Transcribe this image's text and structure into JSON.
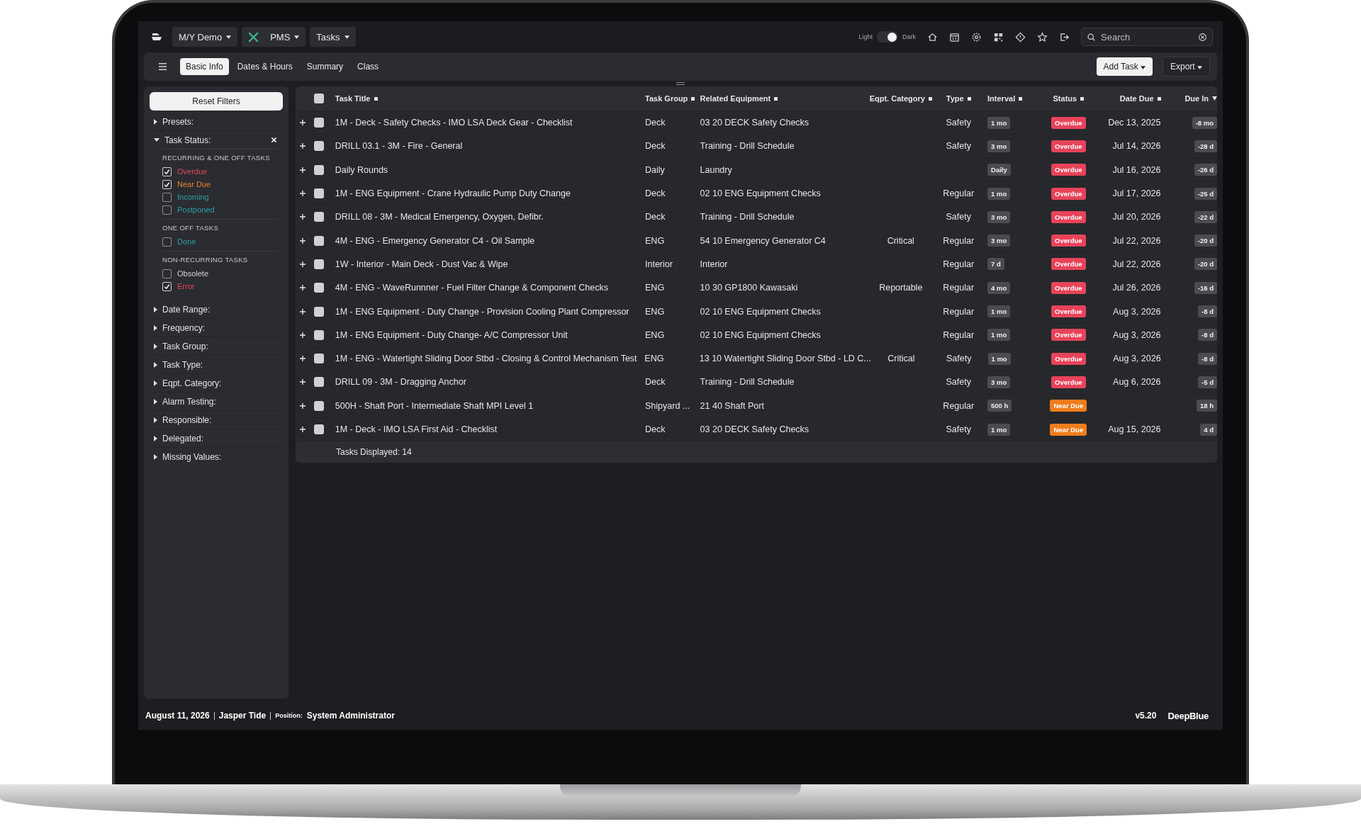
{
  "topbar": {
    "menus": [
      {
        "label": "M/Y Demo",
        "kind": "plain"
      },
      {
        "label": "PMS",
        "kind": "tools"
      },
      {
        "label": "Tasks",
        "kind": "plain"
      }
    ],
    "theme": {
      "light_label": "Light",
      "dark_label": "Dark",
      "on": true
    },
    "search": {
      "placeholder": "Search"
    }
  },
  "subbar": {
    "tabs": [
      {
        "label": "Basic Info",
        "selected": true
      },
      {
        "label": "Dates & Hours",
        "selected": false
      },
      {
        "label": "Summary",
        "selected": false
      },
      {
        "label": "Class",
        "selected": false
      }
    ],
    "buttons": [
      {
        "label": "Add Task",
        "kind": "primary"
      },
      {
        "label": "Export",
        "kind": "secondary"
      }
    ]
  },
  "sidebar": {
    "reset": "Reset Filters",
    "filters": [
      {
        "label": "Presets:",
        "expanded": false
      },
      {
        "label": "Task Status:",
        "expanded": true,
        "groups": [
          {
            "heading": "RECURRING & ONE OFF TASKS",
            "options": [
              {
                "label": "Overdue",
                "checked": true,
                "color": "#e8435a"
              },
              {
                "label": "Near Due",
                "checked": true,
                "color": "#ee7f2d"
              },
              {
                "label": "Incoming",
                "checked": false,
                "color": "#2b9fa6"
              },
              {
                "label": "Postponed",
                "checked": false,
                "color": "#2b9fa6"
              }
            ]
          },
          {
            "heading": "ONE OFF TASKS",
            "options": [
              {
                "label": "Done",
                "checked": false,
                "color": "#2b9fa6"
              }
            ]
          },
          {
            "heading": "NON-RECURRING TASKS",
            "options": [
              {
                "label": "Obsolete",
                "checked": false,
                "color": "#d4d5d8"
              },
              {
                "label": "Error",
                "checked": true,
                "color": "#e8435a"
              }
            ]
          }
        ]
      },
      {
        "label": "Date Range:",
        "expanded": false
      },
      {
        "label": "Frequency:",
        "expanded": false
      },
      {
        "label": "Task Group:",
        "expanded": false
      },
      {
        "label": "Task Type:",
        "expanded": false
      },
      {
        "label": "Eqpt. Category:",
        "expanded": false
      },
      {
        "label": "Alarm Testing:",
        "expanded": false
      },
      {
        "label": "Responsible:",
        "expanded": false
      },
      {
        "label": "Delegated:",
        "expanded": false
      },
      {
        "label": "Missing Values:",
        "expanded": false
      }
    ]
  },
  "table": {
    "select_all_checked": false,
    "columns": [
      {
        "label": "Task Title",
        "sorted": false
      },
      {
        "label": "Task Group",
        "sorted": false
      },
      {
        "label": "Related Equipment",
        "sorted": false
      },
      {
        "label": "Eqpt. Category",
        "sorted": false
      },
      {
        "label": "Type",
        "sorted": false
      },
      {
        "label": "Interval",
        "sorted": false
      },
      {
        "label": "Status",
        "sorted": false
      },
      {
        "label": "Date Due",
        "sorted": false
      },
      {
        "label": "Due In",
        "sorted": true
      }
    ],
    "rows": [
      {
        "checked": false,
        "title": "1M - Deck - Safety Checks - IMO LSA Deck Gear - Checklist",
        "group": "Deck",
        "equipment": "03 20 DECK Safety Checks",
        "category": "",
        "type": "Safety",
        "interval": "1 mo",
        "status": {
          "label": "Overdue",
          "kind": "overdue"
        },
        "date_due": "Dec 13, 2025",
        "due_in": "-8 mo"
      },
      {
        "checked": false,
        "title": "DRILL 03.1 - 3M - Fire - General",
        "group": "Deck",
        "equipment": "Training - Drill Schedule",
        "category": "",
        "type": "Safety",
        "interval": "3 mo",
        "status": {
          "label": "Overdue",
          "kind": "overdue"
        },
        "date_due": "Jul 14, 2026",
        "due_in": "-28 d"
      },
      {
        "checked": false,
        "title": "Daily Rounds",
        "group": "Daily",
        "equipment": "Laundry",
        "category": "",
        "type": "",
        "interval": "Daily",
        "status": {
          "label": "Overdue",
          "kind": "overdue"
        },
        "date_due": "Jul 16, 2026",
        "due_in": "-26 d"
      },
      {
        "checked": false,
        "title": "1M - ENG Equipment - Crane Hydraulic Pump Duty Change",
        "group": "Deck",
        "equipment": "02 10 ENG Equipment Checks",
        "category": "",
        "type": "Regular",
        "interval": "1 mo",
        "status": {
          "label": "Overdue",
          "kind": "overdue"
        },
        "date_due": "Jul 17, 2026",
        "due_in": "-25 d"
      },
      {
        "checked": false,
        "title": "DRILL 08 - 3M - Medical Emergency, Oxygen, Defibr.",
        "group": "Deck",
        "equipment": "Training - Drill Schedule",
        "category": "",
        "type": "Safety",
        "interval": "3 mo",
        "status": {
          "label": "Overdue",
          "kind": "overdue"
        },
        "date_due": "Jul 20, 2026",
        "due_in": "-22 d"
      },
      {
        "checked": false,
        "title": "4M - ENG - Emergency Generator C4 - Oil Sample",
        "group": "ENG",
        "equipment": "54 10 Emergency Generator C4",
        "category": "Critical",
        "type": "Regular",
        "interval": "3 mo",
        "status": {
          "label": "Overdue",
          "kind": "overdue"
        },
        "date_due": "Jul 22, 2026",
        "due_in": "-20 d"
      },
      {
        "checked": false,
        "title": "1W - Interior - Main Deck - Dust Vac & Wipe",
        "group": "Interior",
        "equipment": "Interior",
        "category": "",
        "type": "Regular",
        "interval": "7 d",
        "status": {
          "label": "Overdue",
          "kind": "overdue"
        },
        "date_due": "Jul 22, 2026",
        "due_in": "-20 d"
      },
      {
        "checked": false,
        "title": "4M - ENG - WaveRunnner - Fuel Filter Change & Component Checks",
        "group": "ENG",
        "equipment": "10 30 GP1800 Kawasaki",
        "category": "Reportable",
        "type": "Regular",
        "interval": "4 mo",
        "status": {
          "label": "Overdue",
          "kind": "overdue"
        },
        "date_due": "Jul 26, 2026",
        "due_in": "-16 d"
      },
      {
        "checked": false,
        "title": "1M - ENG Equipment - Duty Change - Provision Cooling Plant Compressor",
        "group": "ENG",
        "equipment": "02 10 ENG Equipment Checks",
        "category": "",
        "type": "Regular",
        "interval": "1 mo",
        "status": {
          "label": "Overdue",
          "kind": "overdue"
        },
        "date_due": "Aug 3, 2026",
        "due_in": "-8 d"
      },
      {
        "checked": false,
        "title": "1M - ENG Equipment - Duty Change- A/C Compressor Unit",
        "group": "ENG",
        "equipment": "02 10 ENG Equipment Checks",
        "category": "",
        "type": "Regular",
        "interval": "1 mo",
        "status": {
          "label": "Overdue",
          "kind": "overdue"
        },
        "date_due": "Aug 3, 2026",
        "due_in": "-8 d"
      },
      {
        "checked": false,
        "title": "1M - ENG - Watertight Sliding Door Stbd - Closing & Control Mechanism Test",
        "group": "ENG",
        "equipment": "13 10 Watertight Sliding Door Stbd - LD C...",
        "category": "Critical",
        "type": "Safety",
        "interval": "1 mo",
        "status": {
          "label": "Overdue",
          "kind": "overdue"
        },
        "date_due": "Aug 3, 2026",
        "due_in": "-8 d"
      },
      {
        "checked": false,
        "title": "DRILL 09 - 3M - Dragging Anchor",
        "group": "Deck",
        "equipment": "Training - Drill Schedule",
        "category": "",
        "type": "Safety",
        "interval": "3 mo",
        "status": {
          "label": "Overdue",
          "kind": "overdue"
        },
        "date_due": "Aug 6, 2026",
        "due_in": "-5 d"
      },
      {
        "checked": false,
        "title": "500H - Shaft Port - Intermediate Shaft MPI Level 1",
        "group": "Shipyard ...",
        "equipment": "21 40 Shaft Port",
        "category": "",
        "type": "Regular",
        "interval": "500 h",
        "status": {
          "label": "Near Due",
          "kind": "near"
        },
        "date_due": "",
        "due_in": "18 h"
      },
      {
        "checked": false,
        "title": "1M - Deck - IMO LSA First Aid - Checklist",
        "group": "Deck",
        "equipment": "03 20 DECK Safety Checks",
        "category": "",
        "type": "Safety",
        "interval": "1 mo",
        "status": {
          "label": "Near Due",
          "kind": "near"
        },
        "date_due": "Aug 15, 2026",
        "due_in": "4 d"
      }
    ],
    "footer": "Tasks Displayed: 14"
  },
  "status_bar": {
    "date": "August 11, 2026",
    "user": "Jasper Tide",
    "position_label": "Position:",
    "position": "System Administrator",
    "version": "v5.20",
    "brand": "DeepBlue"
  }
}
